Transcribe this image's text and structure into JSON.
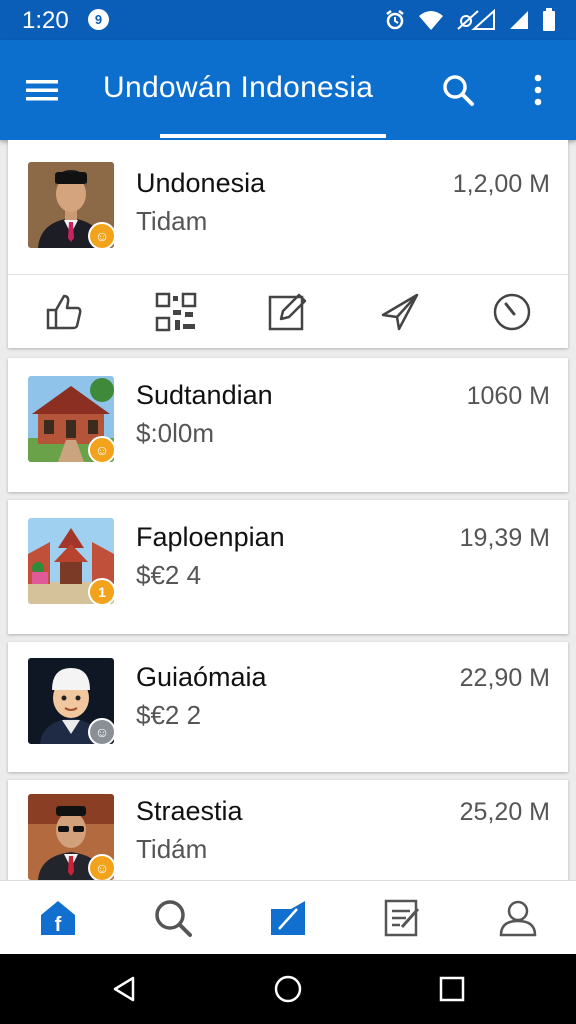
{
  "status_bar": {
    "time": "1:20",
    "badge": "9",
    "icons": [
      "alarm-icon",
      "wifi-icon",
      "data-saver-icon",
      "signal-icon",
      "battery-icon"
    ]
  },
  "app_bar": {
    "title": "Undowán Indonesia",
    "icons": [
      "menu-icon",
      "search-icon",
      "more-vert-icon"
    ]
  },
  "items": [
    {
      "name": "Undonesia",
      "subtitle": "Tidam",
      "value": "1,2,00 M",
      "avatar": "portrait-man-suit",
      "badge": "☺"
    },
    {
      "name": "Sudtandian",
      "subtitle": "$:0l0m",
      "value": "1060 M",
      "avatar": "temple-building",
      "badge": "☺"
    },
    {
      "name": "Faploenpian",
      "subtitle": "$€2 4",
      "value": "19,39 M",
      "avatar": "pagoda-street",
      "badge": "1"
    },
    {
      "name": "Guiaómaia",
      "subtitle": "$€2 2",
      "value": "22,90 M",
      "avatar": "cartoon-man-cap",
      "badge": "☺"
    },
    {
      "name": "Straestia",
      "subtitle": "Tidám",
      "value": "25,20 M",
      "avatar": "man-sunglasses",
      "badge": "☺"
    }
  ],
  "actions": [
    "like-icon",
    "qr-code-icon",
    "edit-icon",
    "send-icon",
    "clock-icon"
  ],
  "bottom_nav": [
    "home-icon",
    "search-icon",
    "compose-icon",
    "notes-icon",
    "profile-icon"
  ],
  "system_nav": [
    "back-icon",
    "home-circle-icon",
    "recents-icon"
  ],
  "colors": {
    "primary": "#0d6fcd",
    "status_bar": "#0b5eb8",
    "badge": "#f3a21b"
  }
}
